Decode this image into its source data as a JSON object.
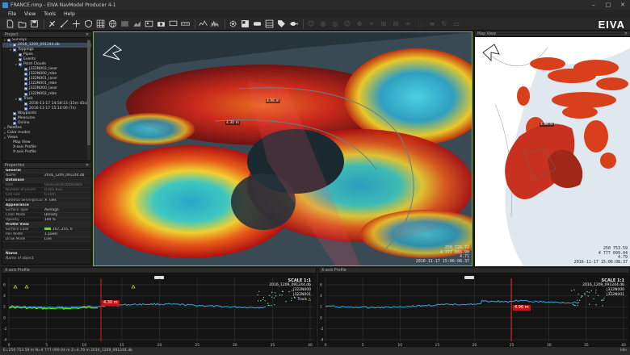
{
  "window": {
    "title": "FRANCE.nmp - EIVA NavModel Producer 4-1"
  },
  "menu": [
    "File",
    "View",
    "Tools",
    "Help"
  ],
  "logo": "EIVA",
  "project": {
    "title": "Project",
    "tree": [
      {
        "label": "Surveys",
        "level": 0,
        "checked": true,
        "arrow": true
      },
      {
        "label": "2016_1209_091244.db",
        "level": 1,
        "checked": true,
        "arrow": true,
        "selected": true
      },
      {
        "label": "Toppings",
        "level": 1,
        "checked": true,
        "arrow": true
      },
      {
        "label": "Pipes",
        "level": 2,
        "checked": true,
        "arrow": false
      },
      {
        "label": "Events",
        "level": 2,
        "checked": true,
        "arrow": false
      },
      {
        "label": "Point Clouds",
        "level": 2,
        "checked": true,
        "arrow": true
      },
      {
        "label": "J322N002_laser",
        "level": 3,
        "checked": true,
        "arrow": false
      },
      {
        "label": "J322N000_mbe",
        "level": 3,
        "checked": true,
        "arrow": false
      },
      {
        "label": "J322N001_laser",
        "level": 3,
        "checked": true,
        "arrow": false
      },
      {
        "label": "J322N001_mbe",
        "level": 3,
        "checked": true,
        "arrow": false
      },
      {
        "label": "J322N000_laser",
        "level": 3,
        "checked": true,
        "arrow": false
      },
      {
        "label": "J322N002_mbe",
        "level": 3,
        "checked": true,
        "arrow": false
      },
      {
        "label": "Track",
        "level": 2,
        "checked": true,
        "arrow": true
      },
      {
        "label": "2016-11-17 14:58:13 (15m 45s)",
        "level": 3,
        "checked": true,
        "arrow": false
      },
      {
        "label": "2016-11-17 15:14:00 (7s)",
        "level": 3,
        "checked": true,
        "arrow": false
      },
      {
        "label": "Waypoints",
        "level": 1,
        "checked": true,
        "arrow": false
      },
      {
        "label": "Measures",
        "level": 1,
        "checked": true,
        "arrow": false
      },
      {
        "label": "Online",
        "level": 1,
        "checked": true,
        "arrow": false
      },
      {
        "label": "Palettes",
        "level": 0,
        "checked": false,
        "arrow": true
      },
      {
        "label": "Color modes",
        "level": 0,
        "checked": false,
        "arrow": true
      },
      {
        "label": "Views",
        "level": 0,
        "checked": false,
        "arrow": true
      },
      {
        "label": "Map View",
        "level": 1,
        "checked": false,
        "arrow": false
      },
      {
        "label": "X-axis Profile",
        "level": 1,
        "checked": false,
        "arrow": false
      },
      {
        "label": "X-axis Profile",
        "level": 1,
        "checked": false,
        "arrow": false
      }
    ]
  },
  "properties": {
    "title": "Properties",
    "rows": [
      {
        "type": "cat",
        "k": "General"
      },
      {
        "k": "Name",
        "v": "2016_1209_091244.db"
      },
      {
        "type": "cat",
        "k": "Database"
      },
      {
        "k": "Path",
        "v": "\\\\eiva.local\\Data\\Data",
        "muted": true
      },
      {
        "k": "Number of points",
        "v": "0 001 833",
        "muted": true
      },
      {
        "k": "Cell size",
        "v": "0.10m",
        "muted": true
      },
      {
        "k": "External Servings/Loads",
        "v": "✕   Tiles"
      },
      {
        "type": "cat",
        "k": "Appearance"
      },
      {
        "k": "Surface Type",
        "v": "Average"
      },
      {
        "k": "Color Mode",
        "v": "Density"
      },
      {
        "k": "Opacity",
        "v": "100 %"
      },
      {
        "type": "cat",
        "k": "Profile View"
      },
      {
        "k": "Surface Color",
        "v": "107, 255, 0",
        "swatch": true
      },
      {
        "k": "Pen Width",
        "v": "1 pixels"
      },
      {
        "k": "Draw Mode",
        "v": "Line"
      }
    ],
    "footer_title": "Name",
    "footer_desc": "Name of object"
  },
  "view3d": {
    "labels": [
      {
        "text": "4.96 m",
        "x": 213,
        "y": 86
      },
      {
        "text": "4.30 m",
        "x": 163,
        "y": 113
      }
    ],
    "coords": [
      "250 726.72",
      "4 777 065.90",
      "4.71",
      "2016-11-17 15:06:08.37"
    ]
  },
  "mapview": {
    "title": "Map View",
    "label": "4.96 m",
    "coords": [
      "250 753.59",
      "4 777 099.04",
      "4.79",
      "2016-11-17 15:06:08.37"
    ]
  },
  "profiles": [
    {
      "title": "X-axis Profile",
      "legend": [
        "SCALE 1:1",
        "2016_1209_091244.db",
        "J322N000",
        "J322N001",
        "Track"
      ],
      "tag": "4.30 m",
      "xticks": [
        "0",
        "5",
        "10",
        "15",
        "20",
        "25",
        "30",
        "35",
        "40"
      ],
      "yticks": [
        "6",
        "4",
        "2",
        "0",
        "-2",
        "-4"
      ]
    },
    {
      "title": "X-axis Profile",
      "legend": [
        "SCALE 1:1",
        "2016_1209_091244.db",
        "J322N000",
        "J322N001"
      ],
      "tag": "4.96 m",
      "xticks": [
        "0",
        "5",
        "10",
        "15",
        "20",
        "25",
        "30",
        "35",
        "40"
      ],
      "yticks": [
        "6",
        "4",
        "2",
        "0",
        "-2",
        "-4"
      ]
    }
  ],
  "status": {
    "left": "E=250 753.59 m N=4 777 099.04 m Z=4.79 m 2016_1209_091244.db",
    "right": "Idle"
  },
  "colors": {
    "accent": "#7cb82f",
    "profile_red": "#e02020",
    "surface_green": "#6bff00"
  }
}
